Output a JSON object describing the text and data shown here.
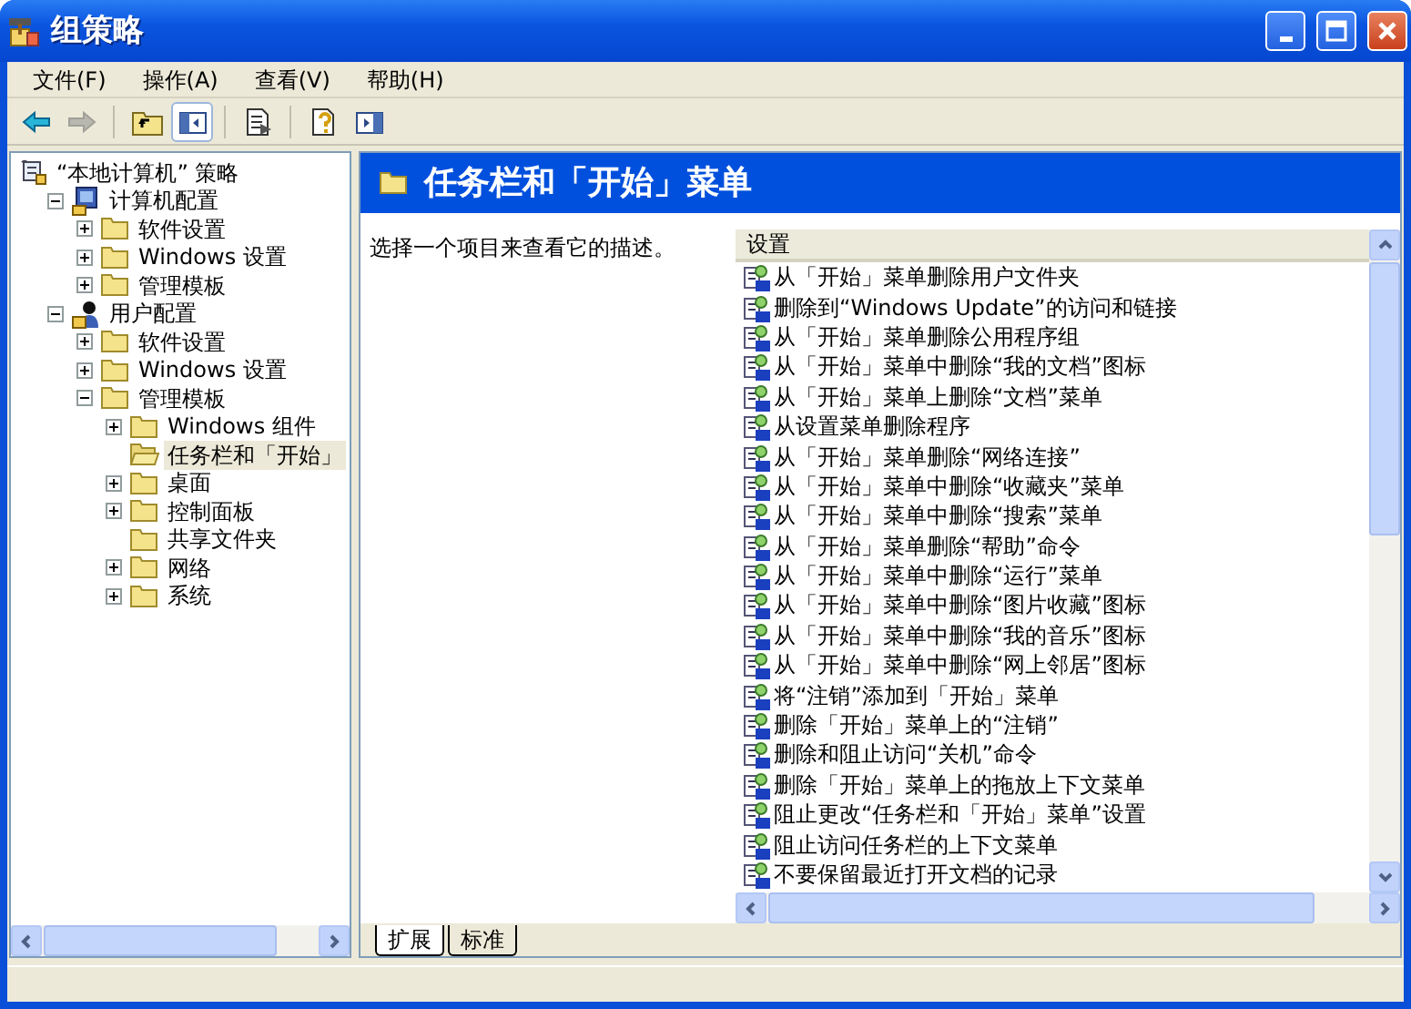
{
  "window": {
    "title": "组策略"
  },
  "menu": [
    "文件(F)",
    "操作(A)",
    "查看(V)",
    "帮助(H)"
  ],
  "toolbar": [
    {
      "kind": "back",
      "disabled": false,
      "pressed": false
    },
    {
      "kind": "forward",
      "disabled": true,
      "pressed": false
    },
    {
      "kind": "sep"
    },
    {
      "kind": "up",
      "pressed": false
    },
    {
      "kind": "tree",
      "pressed": true
    },
    {
      "kind": "sep"
    },
    {
      "kind": "export",
      "pressed": false
    },
    {
      "kind": "sep"
    },
    {
      "kind": "help",
      "pressed": false
    },
    {
      "kind": "pane",
      "pressed": false
    }
  ],
  "tree": [
    {
      "label": "“本地计算机” 策略",
      "kind": "policy",
      "selected": false,
      "children": [
        {
          "label": "计算机配置",
          "kind": "computer",
          "expanded": true,
          "selected": false,
          "children": [
            {
              "label": "软件设置",
              "kind": "folder",
              "expanded": false,
              "selected": false
            },
            {
              "label": "Windows 设置",
              "kind": "folder",
              "expanded": false,
              "selected": false
            },
            {
              "label": "管理模板",
              "kind": "folder",
              "expanded": false,
              "selected": false
            }
          ]
        },
        {
          "label": "用户配置",
          "kind": "user",
          "expanded": true,
          "selected": false,
          "children": [
            {
              "label": "软件设置",
              "kind": "folder",
              "expanded": false,
              "selected": false
            },
            {
              "label": "Windows 设置",
              "kind": "folder",
              "expanded": false,
              "selected": false
            },
            {
              "label": "管理模板",
              "kind": "folder",
              "expanded": true,
              "selected": false,
              "children": [
                {
                  "label": "Windows 组件",
                  "kind": "folder",
                  "expanded": false,
                  "selected": false
                },
                {
                  "label": "任务栏和「开始」",
                  "kind": "open-folder",
                  "selected": true
                },
                {
                  "label": "桌面",
                  "kind": "folder",
                  "expanded": false,
                  "selected": false
                },
                {
                  "label": "控制面板",
                  "kind": "folder",
                  "expanded": false,
                  "selected": false
                },
                {
                  "label": "共享文件夹",
                  "kind": "folder",
                  "selected": false
                },
                {
                  "label": "网络",
                  "kind": "folder",
                  "expanded": false,
                  "selected": false
                },
                {
                  "label": "系统",
                  "kind": "folder",
                  "expanded": false,
                  "selected": false
                }
              ]
            }
          ]
        }
      ]
    }
  ],
  "details": {
    "title": "任务栏和「开始」菜单",
    "description": "选择一个项目来查看它的描述。",
    "column": "设置",
    "settings": [
      "从「开始」菜单删除用户文件夹",
      "删除到“Windows Update”的访问和链接",
      "从「开始」菜单删除公用程序组",
      "从「开始」菜单中删除“我的文档”图标",
      "从「开始」菜单上删除“文档”菜单",
      "从设置菜单删除程序",
      "从「开始」菜单删除“网络连接”",
      "从「开始」菜单中删除“收藏夹”菜单",
      "从「开始」菜单中删除“搜索”菜单",
      "从「开始」菜单删除“帮助”命令",
      "从「开始」菜单中删除“运行”菜单",
      "从「开始」菜单中删除“图片收藏”图标",
      "从「开始」菜单中删除“我的音乐”图标",
      "从「开始」菜单中删除“网上邻居”图标",
      "将“注销”添加到「开始」菜单",
      "删除「开始」菜单上的“注销”",
      "删除和阻止访问“关机”命令",
      "删除「开始」菜单上的拖放上下文菜单",
      "阻止更改“任务栏和「开始」菜单”设置",
      "阻止访问任务栏的上下文菜单",
      "不要保留最近打开文档的记录"
    ]
  },
  "tabs": [
    {
      "label": "扩展",
      "selected": true
    },
    {
      "label": "标准",
      "selected": false
    }
  ]
}
